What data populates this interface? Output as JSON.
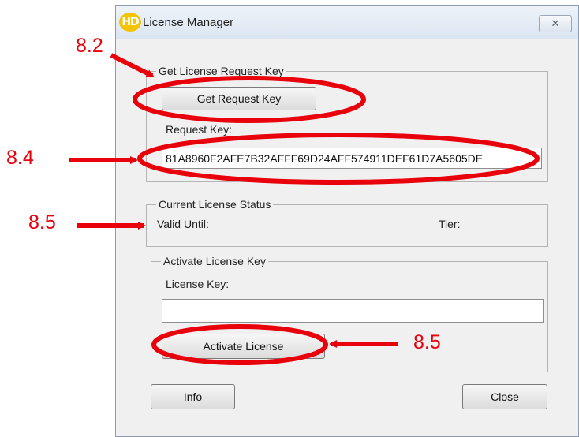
{
  "window": {
    "title": "License Manager",
    "app_icon": "HD",
    "close_glyph": "✕"
  },
  "get_key_group": {
    "legend": "Get License Request Key",
    "button_label": "Get Request Key",
    "request_key_label": "Request Key:",
    "request_key_value": "81A8960F2AFE7B32AFFF69D24AFF574911DEF61D7A5605DE"
  },
  "status_group": {
    "legend": "Current License Status",
    "valid_until_label": "Valid Until:",
    "tier_label": "Tier:"
  },
  "activate_group": {
    "legend": "Activate License Key",
    "license_key_label": "License Key:",
    "license_key_value": "",
    "button_label": "Activate License"
  },
  "footer": {
    "info_label": "Info",
    "close_label": "Close"
  },
  "annotations": {
    "a1": "8.2",
    "a2": "8.4",
    "a3": "8.5",
    "a4": "8.5",
    "color": "#e8000b"
  }
}
